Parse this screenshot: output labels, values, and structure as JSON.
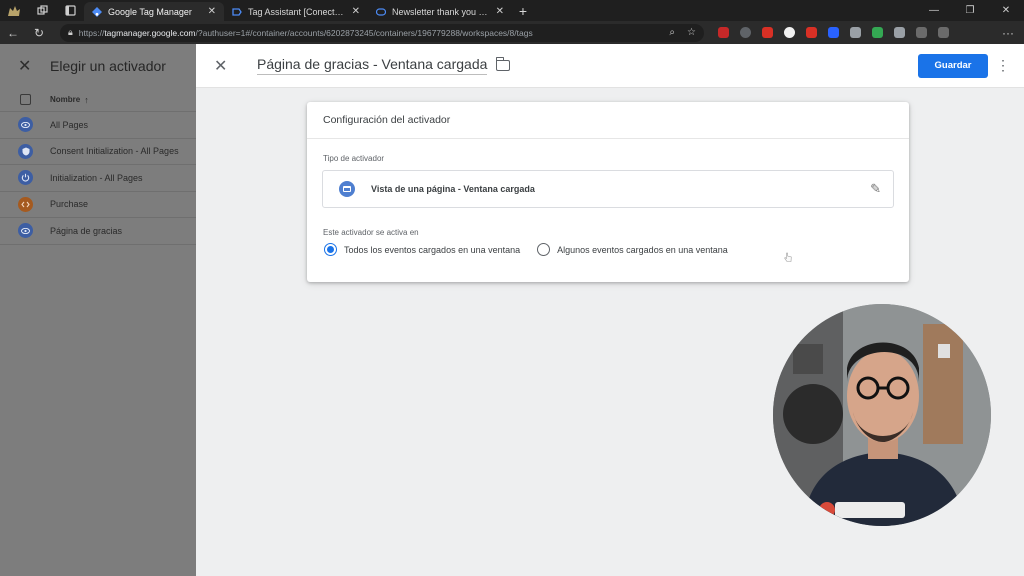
{
  "browser": {
    "tabs": [
      {
        "label": "Google Tag Manager",
        "active": true
      },
      {
        "label": "Tag Assistant [Conectado]",
        "active": false
      },
      {
        "label": "Newsletter thank you - Mi Super",
        "active": false
      }
    ],
    "url": {
      "scheme": "https://",
      "domain": "tagmanager.google.com",
      "path": "/?authuser=1#/container/accounts/6202873245/containers/196779288/workspaces/8/tags"
    }
  },
  "left_panel": {
    "title": "Elegir un activador",
    "column_header": "Nombre",
    "items": [
      {
        "label": "All Pages",
        "icon": "eye-icon",
        "color": "blue"
      },
      {
        "label": "Consent Initialization - All Pages",
        "icon": "shield-icon",
        "color": "blue"
      },
      {
        "label": "Initialization - All Pages",
        "icon": "power-icon",
        "color": "blue"
      },
      {
        "label": "Purchase",
        "icon": "code-icon",
        "color": "orange"
      },
      {
        "label": "Página de gracias",
        "icon": "eye-icon",
        "color": "blue"
      }
    ]
  },
  "editor": {
    "title": "Página de gracias - Ventana cargada",
    "save_label": "Guardar"
  },
  "card": {
    "header": "Configuración del activador",
    "type_label": "Tipo de activador",
    "type_value": "Vista de una página - Ventana cargada",
    "fires_on_label": "Este activador se activa en",
    "options": [
      {
        "label": "Todos los eventos cargados en una ventana",
        "selected": true
      },
      {
        "label": "Algunos eventos cargados en una ventana",
        "selected": false
      }
    ]
  },
  "colors": {
    "primary": "#1a73e8",
    "trigger_blue": "#4285f4",
    "trigger_orange": "#e8710a"
  }
}
